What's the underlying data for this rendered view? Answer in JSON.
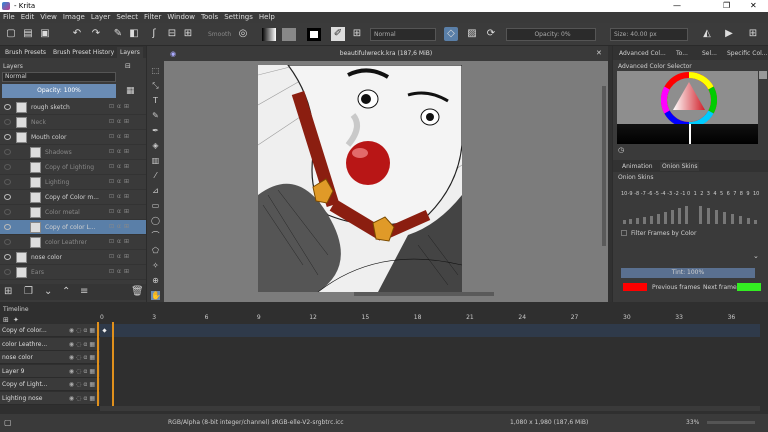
{
  "window": {
    "title": "- Krita",
    "controls": [
      "—",
      "❐",
      "✕"
    ]
  },
  "menu": [
    "File",
    "Edit",
    "View",
    "Image",
    "Layer",
    "Select",
    "Filter",
    "Window",
    "Tools",
    "Settings",
    "Help"
  ],
  "toolbar": {
    "smooth_label": "Smooth",
    "blend_mode": "Normal",
    "opacity": "Opacity: 0%",
    "size": "Size: 40.00 px"
  },
  "left_tabs": [
    "Brush Presets",
    "Brush Preset History",
    "Layers"
  ],
  "layers_panel": {
    "title": "Layers",
    "blend": "Normal",
    "opacity": "Opacity: 100%"
  },
  "layers": [
    {
      "name": "rough sketch",
      "visible": true,
      "selected": false,
      "indent": 0
    },
    {
      "name": "Neck",
      "visible": false,
      "selected": false,
      "indent": 0
    },
    {
      "name": "Mouth color",
      "visible": true,
      "selected": false,
      "indent": 0
    },
    {
      "name": "Shadows",
      "visible": false,
      "selected": false,
      "indent": 1
    },
    {
      "name": "Copy of Lighting",
      "visible": false,
      "selected": false,
      "indent": 1
    },
    {
      "name": "Lighting",
      "visible": false,
      "selected": false,
      "indent": 1
    },
    {
      "name": "Copy of Color m...",
      "visible": true,
      "selected": false,
      "indent": 1
    },
    {
      "name": "Color metal",
      "visible": false,
      "selected": false,
      "indent": 1
    },
    {
      "name": "Copy of color L...",
      "visible": true,
      "selected": true,
      "indent": 1
    },
    {
      "name": "color Leathrer",
      "visible": false,
      "selected": false,
      "indent": 1
    },
    {
      "name": "nose color",
      "visible": true,
      "selected": false,
      "indent": 0
    },
    {
      "name": "Ears",
      "visible": false,
      "selected": false,
      "indent": 0
    }
  ],
  "document": {
    "title": "beautifulwreck.kra (187,6 MiB)"
  },
  "right_tabs": [
    "Advanced Col...",
    "To...",
    "Sel...",
    "Specific Col..."
  ],
  "color_selector": {
    "title": "Advanced Color Selector"
  },
  "onion": {
    "tabs": [
      "Animation",
      "Onion Skins"
    ],
    "title": "Onion Skins",
    "numbers": [
      "10",
      "-9",
      "-8",
      "-7",
      "-6",
      "-5",
      "-4",
      "-3",
      "-2",
      "-1",
      "0",
      "1",
      "2",
      "3",
      "4",
      "5",
      "6",
      "7",
      "8",
      "9",
      "10"
    ],
    "filter_label": "Filter Frames by Color",
    "tint": "Tint: 100%",
    "previous": "Previous frames",
    "next": "Next frames",
    "prev_color": "#ff0000",
    "next_color": "#33ee22"
  },
  "timeline": {
    "title": "Timeline",
    "rows": [
      "Copy of color...",
      "color Leathre...",
      "nose color",
      "Layer 9",
      "Copy of Light...",
      "Lighting nose"
    ],
    "frames": [
      "0",
      "3",
      "6",
      "9",
      "12",
      "15",
      "18",
      "21",
      "24",
      "27",
      "30",
      "33",
      "36"
    ]
  },
  "status": {
    "color_space": "RGB/Alpha (8-bit integer/channel)  sRGB-elle-V2-srgbtrc.icc",
    "dims": "1,080 x 1,980 (187,6 MiB)",
    "zoom": "33%"
  }
}
